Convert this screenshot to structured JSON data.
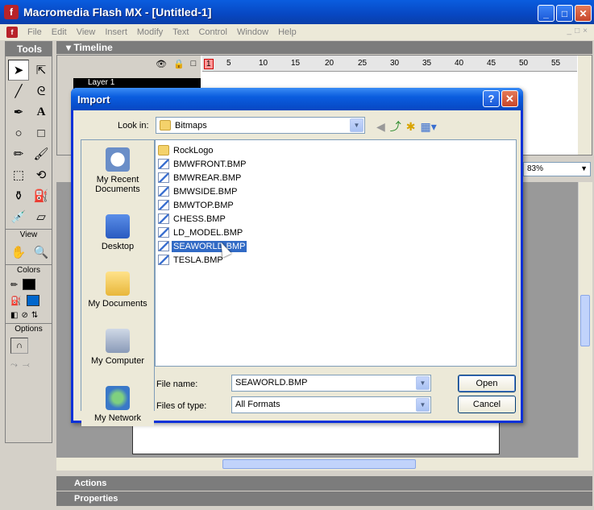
{
  "window": {
    "title": "Macromedia Flash MX - [Untitled-1]",
    "logo_glyph": "f",
    "minimize_glyph": "_",
    "maximize_glyph": "□",
    "close_glyph": "✕"
  },
  "menubar": {
    "items": [
      "File",
      "Edit",
      "View",
      "Insert",
      "Modify",
      "Text",
      "Control",
      "Window",
      "Help"
    ],
    "right_controls": [
      "_",
      "□",
      "×"
    ]
  },
  "tools": {
    "title": "Tools",
    "view_label": "View",
    "colors_label": "Colors",
    "options_label": "Options",
    "stroke_color": "#000000",
    "fill_color": "#0066cc"
  },
  "timeline": {
    "title": "Timeline",
    "frame_numbers": [
      "1",
      "5",
      "10",
      "15",
      "20",
      "25",
      "30",
      "35",
      "40",
      "45",
      "50",
      "55"
    ],
    "layer_name": "Layer 1"
  },
  "stage": {
    "zoom": "83%"
  },
  "panels": {
    "actions": "Actions",
    "properties": "Properties"
  },
  "dialog": {
    "title": "Import",
    "help_glyph": "?",
    "close_glyph": "✕",
    "look_in_label": "Look in:",
    "look_in_value": "Bitmaps",
    "places": [
      "My Recent Documents",
      "Desktop",
      "My Documents",
      "My Computer",
      "My Network"
    ],
    "files": [
      {
        "name": "RockLogo",
        "type": "folder"
      },
      {
        "name": "BMWFRONT.BMP",
        "type": "bmp"
      },
      {
        "name": "BMWREAR.BMP",
        "type": "bmp"
      },
      {
        "name": "BMWSIDE.BMP",
        "type": "bmp"
      },
      {
        "name": "BMWTOP.BMP",
        "type": "bmp"
      },
      {
        "name": "CHESS.BMP",
        "type": "bmp"
      },
      {
        "name": "LD_MODEL.BMP",
        "type": "bmp"
      },
      {
        "name": "SEAWORLD.BMP",
        "type": "bmp",
        "selected": true
      },
      {
        "name": "TESLA.BMP",
        "type": "bmp"
      }
    ],
    "file_name_label": "File name:",
    "file_name_value": "SEAWORLD.BMP",
    "files_of_type_label": "Files of type:",
    "files_of_type_value": "All Formats",
    "open_label": "Open",
    "cancel_label": "Cancel"
  },
  "colors": {
    "accent": "#0a5ddf",
    "selection": "#316ac5"
  }
}
